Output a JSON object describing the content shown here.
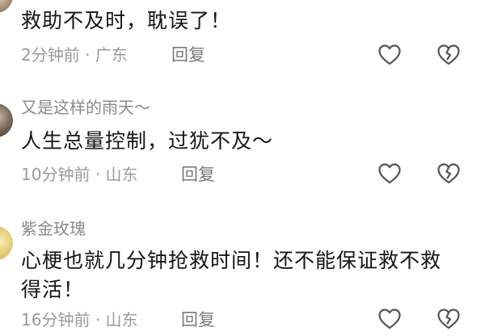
{
  "comments": [
    {
      "author": "",
      "text": "救助不及时，耽误了！",
      "time": "2分钟前",
      "location": "广东",
      "reply_label": "回复"
    },
    {
      "author": "又是这样的雨天～",
      "text": "人生总量控制，过犹不及～",
      "time": "10分钟前",
      "location": "山东",
      "reply_label": "回复"
    },
    {
      "author": "紫金玫瑰",
      "text": "心梗也就几分钟抢救时间！还不能保证救不救得活！",
      "time": "16分钟前",
      "location": "山东",
      "reply_label": "回复"
    }
  ],
  "meta_separator": "·",
  "icons": {
    "like": "heart-outline-icon",
    "dislike": "broken-heart-outline-icon"
  },
  "colors": {
    "text": "#161616",
    "secondary": "#9a9a9a",
    "icon": "#555555"
  }
}
